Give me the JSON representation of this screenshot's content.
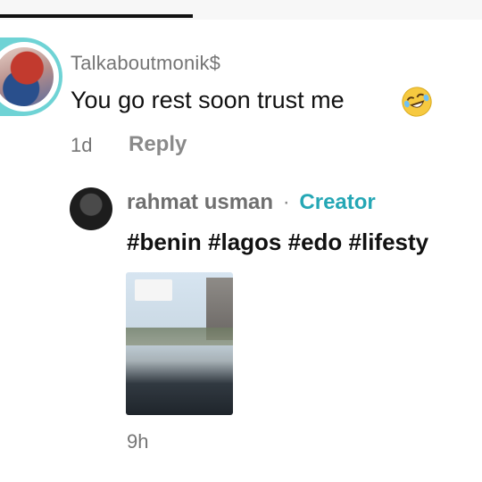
{
  "progress": {
    "fraction": 0.4
  },
  "comment": {
    "username": "Talkaboutmonik$",
    "text": "You go rest soon trust me",
    "emoji": "rolling-on-floor-laughing-emoji",
    "time": "1d",
    "reply_label": "Reply"
  },
  "reply": {
    "username": "rahmat usman",
    "separator": "·",
    "badge": "Creator",
    "text": "#benin #lagos #edo #lifesty",
    "time": "9h",
    "thumbnail": {
      "sign_text": "",
      "overlay_lines": [
        "",
        "",
        ""
      ]
    }
  },
  "colors": {
    "accent_creator": "#25a7b5",
    "story_ring": "#6fd3d5",
    "muted_text": "#757575",
    "primary_text": "#111111"
  }
}
